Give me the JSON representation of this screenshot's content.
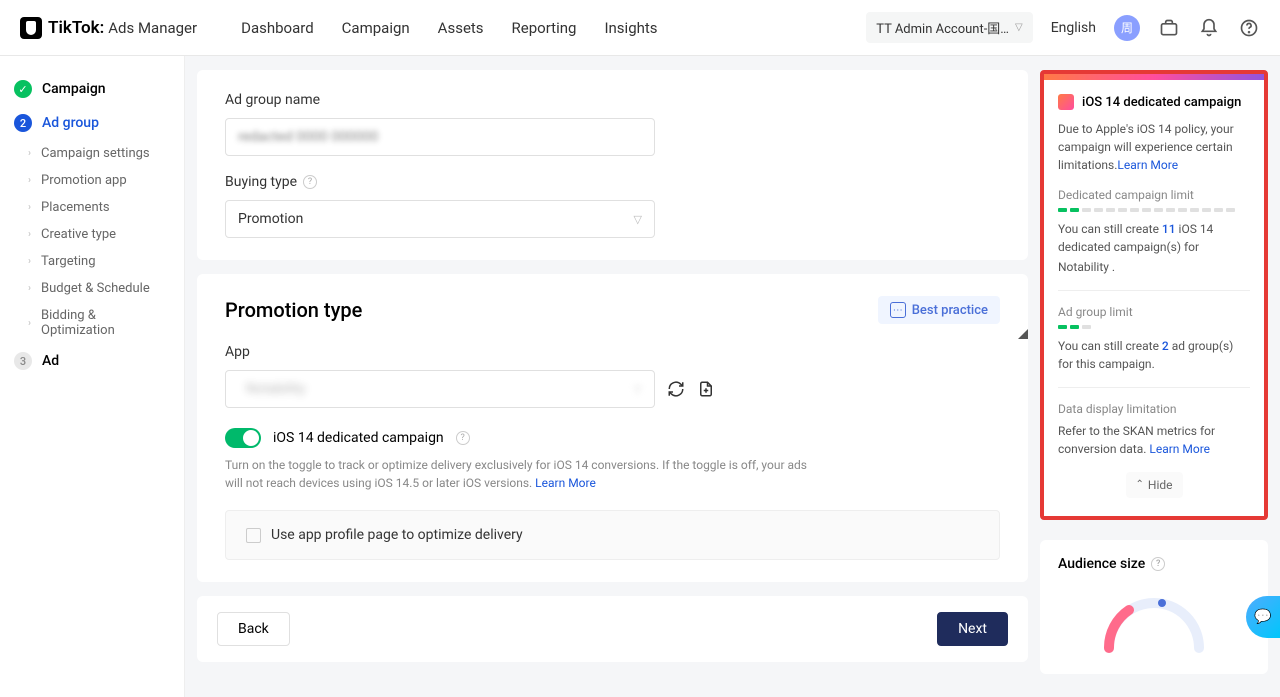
{
  "brand": {
    "name": "TikTok:",
    "sub": "Ads Manager"
  },
  "nav": {
    "items": [
      "Dashboard",
      "Campaign",
      "Assets",
      "Reporting",
      "Insights"
    ],
    "account": "TT Admin Account-国…",
    "lang": "English",
    "avatar_initial": "周"
  },
  "sidebar": {
    "step1": "Campaign",
    "step2_num": "2",
    "step2": "Ad group",
    "subs": [
      "Campaign settings",
      "Promotion app",
      "Placements",
      "Creative type",
      "Targeting",
      "Budget & Schedule",
      "Bidding & Optimization"
    ],
    "step3_num": "3",
    "step3": "Ad"
  },
  "form": {
    "ad_group_name_label": "Ad group name",
    "ad_group_name_value": "redacted 0000 000000",
    "buying_type_label": "Buying type",
    "buying_type_value": "Promotion",
    "promotion_section_title": "Promotion type",
    "best_practice": "Best practice",
    "app_label": "App",
    "app_value": "Notability",
    "toggle_label": "iOS 14 dedicated campaign",
    "helper": "Turn on the toggle to track or optimize delivery exclusively for iOS 14 conversions. If the toggle is off, your ads will not reach devices using iOS 14.5 or later iOS versions. ",
    "helper_link": "Learn More",
    "checkbox_label": "Use app profile page to optimize delivery",
    "back": "Back",
    "next": "Next"
  },
  "panel": {
    "title": "iOS 14 dedicated campaign",
    "intro": "Due to Apple's iOS 14 policy, your campaign will experience certain limitations.",
    "learn_more": "Learn More",
    "sec1_title": "Dedicated campaign limit",
    "sec1_text_a": "You can still create ",
    "sec1_num": "11",
    "sec1_text_b": " iOS 14 dedicated campaign(s) for ",
    "sec1_app": "Notability",
    "sec2_title": "Ad group limit",
    "sec2_text_a": "You can still create ",
    "sec2_num": "2",
    "sec2_text_b": " ad group(s) for this campaign.",
    "sec3_title": "Data display limitation",
    "sec3_text_a": "Refer to the SKAN metrics for conversion data. ",
    "sec3_link": "Learn More",
    "hide": "Hide",
    "audience_title": "Audience size"
  }
}
